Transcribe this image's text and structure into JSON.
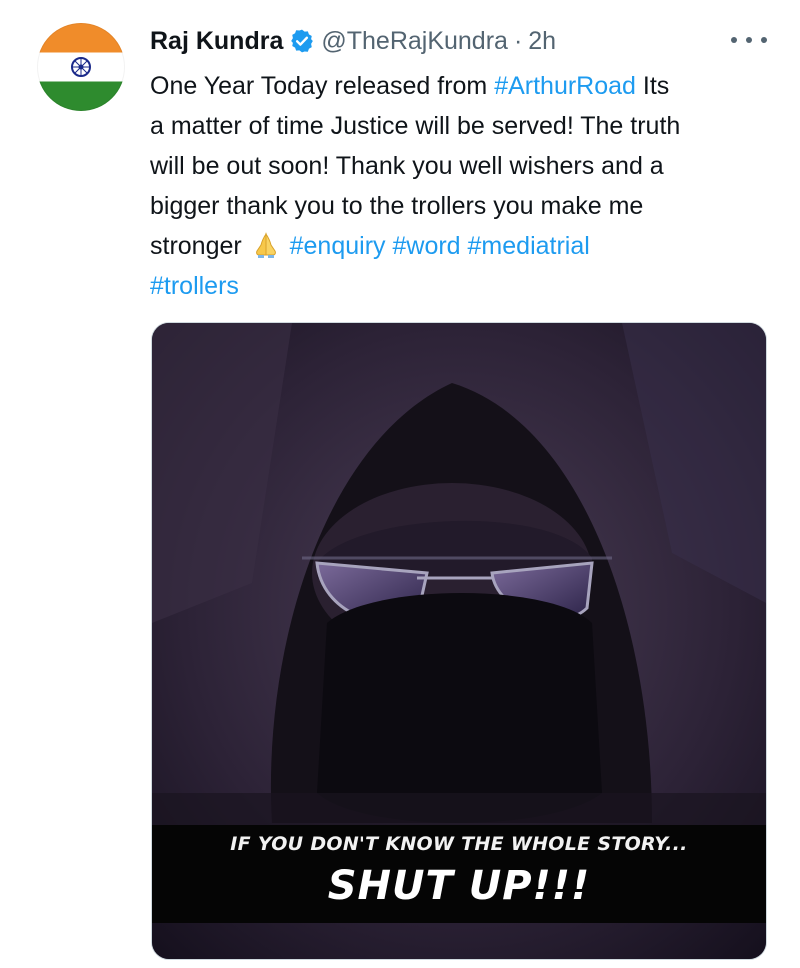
{
  "tweet": {
    "author": {
      "name": "Raj Kundra",
      "handle": "@TheRajKundra",
      "verified": true,
      "avatar": "indian-flag-avatar"
    },
    "separator": "·",
    "time": "2h",
    "more_icon": "more-options-icon",
    "text": {
      "l1_a": "One Year Today released from ",
      "l1_tag": "#ArthurRoad",
      "l1_b": " Its",
      "l2": "a matter of time Justice will be served! The truth",
      "l3": "will be out soon! Thank you well wishers and a",
      "l4": "bigger thank you to the trollers you make me",
      "l5_a": "stronger ",
      "l5_emoji": "folded-hands-emoji",
      "l5_tags": [
        "#enquiry",
        "#word",
        "#mediatrial"
      ],
      "l6_tag": "#trollers"
    },
    "media": {
      "caption_line1": "IF YOU DON'T KNOW THE WHOLE STORY...",
      "caption_line2": "SHUT UP!!!"
    }
  },
  "colors": {
    "link": "#1d9bf0",
    "secondary_text": "#536471",
    "verified_badge": "#1d9bf0"
  }
}
